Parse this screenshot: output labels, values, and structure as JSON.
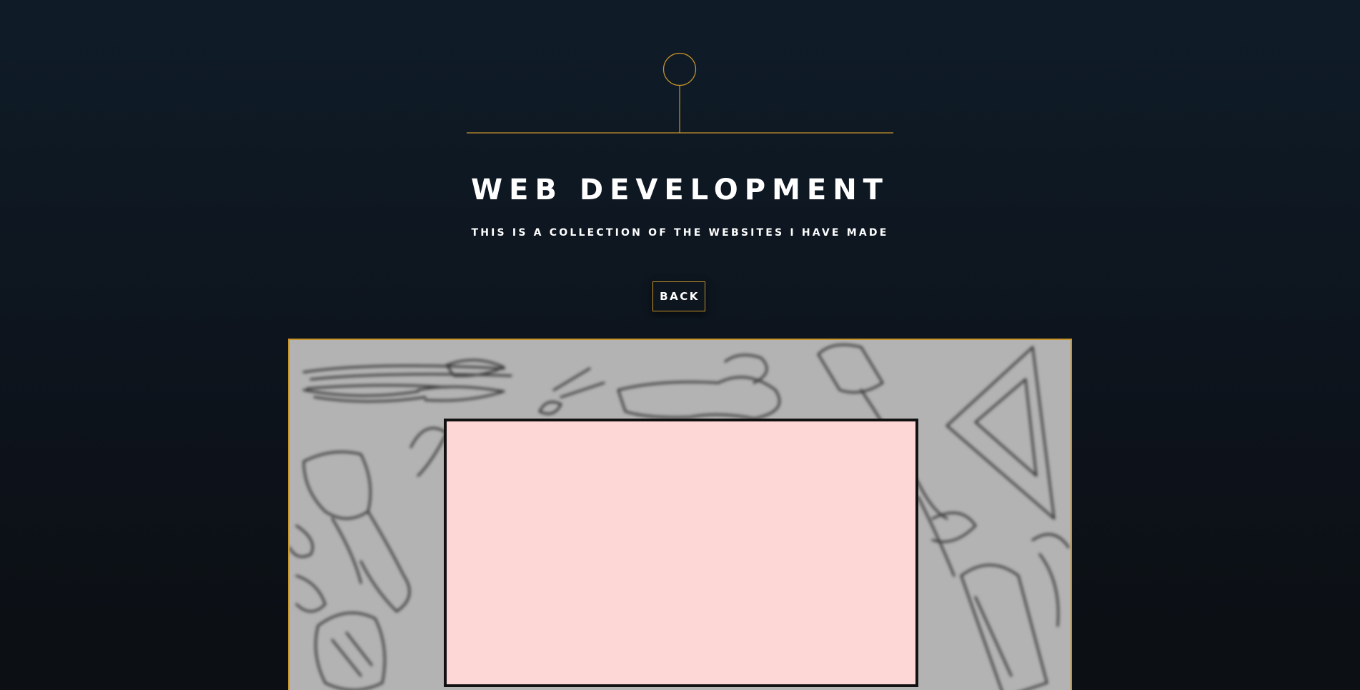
{
  "header": {
    "emblem_icon": "pin-line-emblem-icon",
    "accent_color": "#c8952a",
    "title": "WEB DEVELOPMENT",
    "subtitle": "THIS IS A COLLECTION OF THE WEBSITES I HAVE MADE"
  },
  "actions": {
    "back_label": "BACK"
  },
  "showcase": {
    "background_icon": "tools-doodle-pattern",
    "card_color": "#fdd6d6"
  }
}
